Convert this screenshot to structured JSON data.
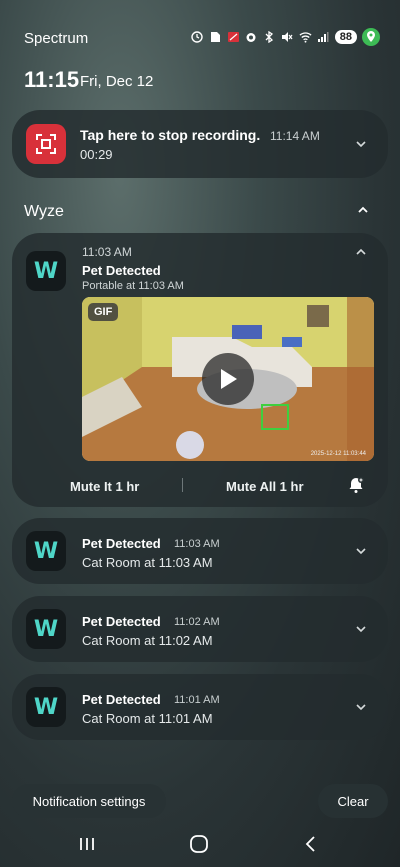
{
  "status_bar": {
    "carrier": "Spectrum",
    "battery": "88",
    "icons": [
      "alarm-icon",
      "sim-icon",
      "cast-icon",
      "alarm-clock-icon",
      "bluetooth-icon",
      "mute-icon",
      "wifi-icon",
      "signal-icon",
      "battery-icon",
      "location-icon"
    ]
  },
  "clock": {
    "time": "11:15",
    "date": "Fri, Dec 12"
  },
  "recording": {
    "title": "Tap here to stop recording.",
    "time": "11:14 AM",
    "elapsed": "00:29",
    "accent": "#d8313a"
  },
  "section": {
    "title": "Wyze"
  },
  "expanded_notification": {
    "app_letter": "W",
    "time": "11:03 AM",
    "title": "Pet Detected",
    "subtitle": "Portable at 11:03 AM",
    "badge": "GIF",
    "timestamp_overlay": "2025-12-12 11:03:44",
    "actions": {
      "mute_one": "Mute It 1 hr",
      "mute_all": "Mute All 1 hr"
    }
  },
  "notifications": [
    {
      "title": "Pet Detected",
      "time": "11:03 AM",
      "subtitle": "Cat Room at 11:03 AM"
    },
    {
      "title": "Pet Detected",
      "time": "11:02 AM",
      "subtitle": "Cat Room at 11:02 AM"
    },
    {
      "title": "Pet Detected",
      "time": "11:01 AM",
      "subtitle": "Cat Room at 11:01 AM"
    }
  ],
  "footer": {
    "settings": "Notification settings",
    "clear": "Clear"
  },
  "nav": {
    "recents_icon": "recents-icon",
    "home_icon": "home-icon",
    "back_icon": "back-icon"
  }
}
